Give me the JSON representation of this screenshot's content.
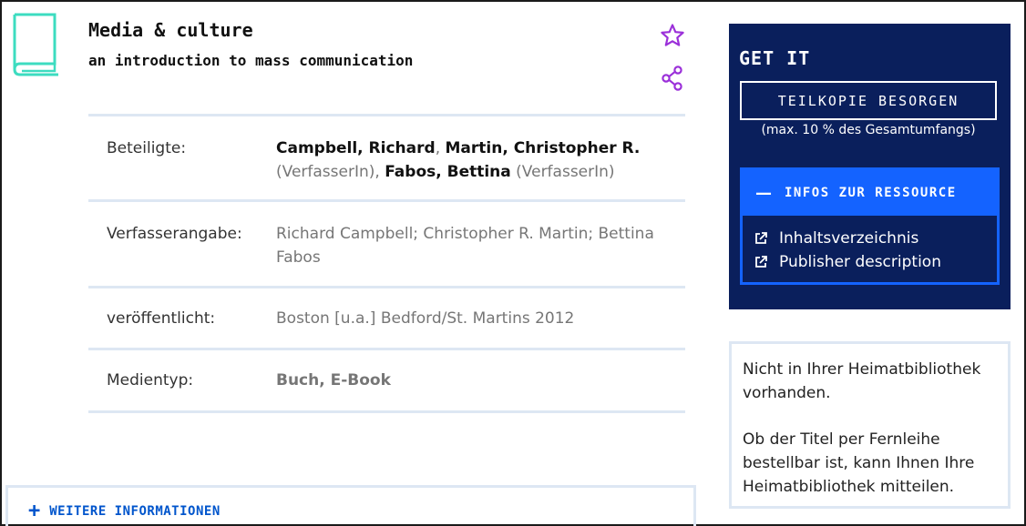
{
  "record": {
    "title": "Media & culture",
    "subtitle": "an introduction to mass communication"
  },
  "meta": {
    "rows": [
      {
        "label": "Beteiligte:"
      },
      {
        "label": "Verfasserangabe:",
        "value": "Richard Campbell; Christopher R. Martin; Bettina Fabos"
      },
      {
        "label": "veröffentlicht:",
        "value": "Boston [u.a.] Bedford/St. Martins 2012"
      },
      {
        "label": "Medientyp:",
        "value": "Buch, E-Book"
      }
    ],
    "contributors": [
      {
        "name": "Campbell, Richard",
        "sep": ", "
      },
      {
        "name": "Martin, Christopher R.",
        "role": " (VerfasserIn)",
        "sep": ", "
      },
      {
        "name": "Fabos, Bettina",
        "role": " (VerfasserIn)"
      }
    ]
  },
  "more": {
    "icon": "plus-icon",
    "label": "WEITERE INFORMATIONEN"
  },
  "getit": {
    "title": "GET IT",
    "teilkopie_label": "TEILKOPIE BESORGEN",
    "teilkopie_note": "(max. 10 % des Gesamtumfangs)",
    "infos": {
      "icon": "minus-icon",
      "label": "INFOS ZUR RESSOURCE",
      "links": [
        {
          "label": "Inhaltsverzeichnis",
          "icon": "external-link-icon"
        },
        {
          "label": "Publisher description",
          "icon": "external-link-icon"
        }
      ]
    }
  },
  "notice": {
    "line1": "Nicht in Ihrer Heimatbibliothek vorhanden.",
    "line2": "Ob der Titel per Fernleihe bestellbar ist, kann Ihnen Ihre Heimatbibliothek mitteilen."
  },
  "icons": {
    "book": "book-icon",
    "star": "star-icon",
    "share": "share-icon"
  },
  "colors": {
    "accent": "#1463ff",
    "navy": "#0a1f5c",
    "book_icon": "#3ddcc0",
    "action_icons": "#9b30d9",
    "link_blue": "#0055cc",
    "divider": "#dde7f3"
  }
}
